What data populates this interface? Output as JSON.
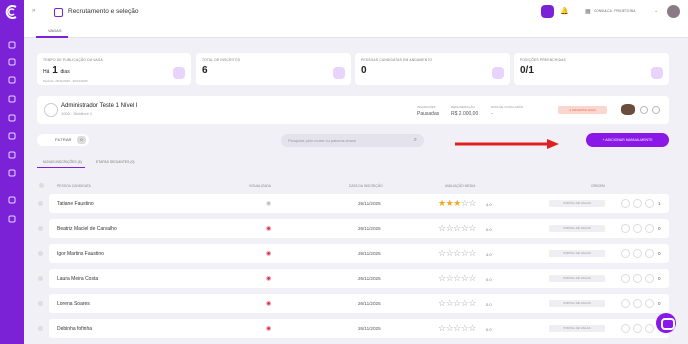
{
  "sidebar": {
    "items": [
      "logo-icon",
      "grid-icon",
      "user-icon",
      "briefcase-icon",
      "rocket-icon",
      "star-icon",
      "heart-icon",
      "lightbulb-icon",
      "calendar-icon",
      "recruit-icon",
      "help-icon",
      "logout-icon"
    ]
  },
  "header": {
    "title": "Recrutamento e seleção",
    "tab": "VAGAS",
    "org": "CONSULCA - PROJETO BIA"
  },
  "stats": [
    {
      "label": "TEMPO DE PUBLICAÇÃO DA VAGA",
      "prefix": "Há",
      "value": "1",
      "unit": "dias",
      "sub": "Período: 26/11/2025 - 06/12/2025"
    },
    {
      "label": "TOTAL DE INSCRITOS",
      "value": "6"
    },
    {
      "label": "PESSOAS CANDIDATAS EM ANDAMENTO",
      "value": "0"
    },
    {
      "label": "POSIÇÕES PREENCHIDAS",
      "value": "0/1"
    }
  ],
  "job": {
    "title": "Administrador Teste 1 Nível I",
    "subtitle": "1003 · Dividivre 1",
    "meta": [
      {
        "label": "INSCRIÇÕES",
        "value": "Pausadas"
      },
      {
        "label": "REMUNERAÇÃO",
        "value": "R$ 2.000,00"
      },
      {
        "label": "DATA DE CONCLUSÃO",
        "value": "-"
      }
    ],
    "badge": "● URGENTE VAGA"
  },
  "toolbar": {
    "filter_label": "FILTRAR",
    "filter_count": "0",
    "search_placeholder": "Pesquise pelo nome ou palavra-chave",
    "add_label": "+ ADICIONAR MANUALMENTE"
  },
  "list_tabs": [
    "NOVAS INSCRIÇÕES (6)",
    "ETAPAS SEGUINTES (0)"
  ],
  "columns": [
    "PESSOA CANDIDATA",
    "VISUALIZADA",
    "DATA DA INSCRIÇÃO",
    "AVALIAÇÃO MÉDIA",
    "ORIGEM"
  ],
  "rows": [
    {
      "name": "Tatiane Faustino",
      "date": "26/11/2025",
      "stars": 3,
      "score": "4.0",
      "origin": "PORTAL DE VAGAS",
      "count": "1"
    },
    {
      "name": "Beatriz Maciel de Carvalho",
      "date": "26/11/2025",
      "stars": 0,
      "score": "0.0",
      "origin": "PORTAL DE VAGAS",
      "count": "0"
    },
    {
      "name": "Igor Martins Faustino",
      "date": "26/11/2025",
      "stars": 0,
      "score": "4.0",
      "origin": "PORTAL DE VAGAS",
      "count": "0"
    },
    {
      "name": "Laura Meira Costa",
      "date": "26/11/2025",
      "stars": 0,
      "score": "0.0",
      "origin": "PORTAL DE VAGAS",
      "count": "0"
    },
    {
      "name": "Lorena Soares",
      "date": "26/11/2025",
      "stars": 0,
      "score": "0.0",
      "origin": "PORTAL DE VAGAS",
      "count": "0"
    },
    {
      "name": "Debinha fofinha",
      "date": "26/11/2025",
      "stars": 0,
      "score": "0.0",
      "origin": "PORTAL DE VAGAS",
      "count": "0"
    }
  ],
  "colors": {
    "accent": "#7b22d6",
    "button": "#8a19e8",
    "star": "#f2a81d",
    "arrow": "#e02020"
  }
}
